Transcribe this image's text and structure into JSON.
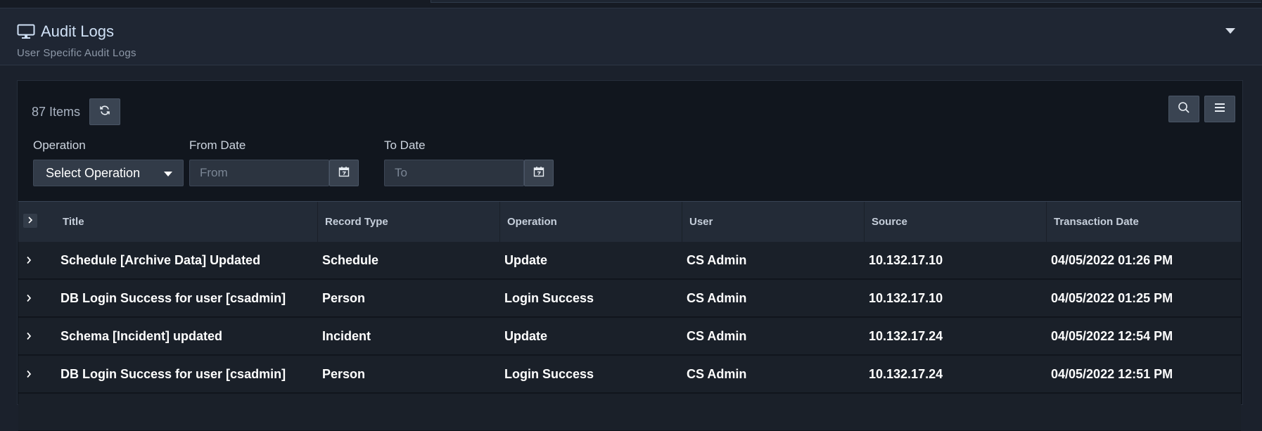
{
  "panel": {
    "title": "Audit Logs",
    "subtitle": "User Specific Audit Logs"
  },
  "toolbar": {
    "items_count": "87 Items",
    "refresh_icon": "refresh-icon",
    "search_icon": "search-icon",
    "menu_icon": "hamburger-menu-icon"
  },
  "filters": {
    "operation_label": "Operation",
    "operation_value": "Select Operation",
    "from_label": "From Date",
    "from_placeholder": "From",
    "to_label": "To Date",
    "to_placeholder": "To"
  },
  "grid": {
    "columns": [
      "Title",
      "Record Type",
      "Operation",
      "User",
      "Source",
      "Transaction Date"
    ],
    "rows": [
      [
        "Schedule [Archive Data] Updated",
        "Schedule",
        "Update",
        "CS Admin",
        "10.132.17.10",
        "04/05/2022 01:26 PM"
      ],
      [
        "DB Login Success for user [csadmin]",
        "Person",
        "Login Success",
        "CS Admin",
        "10.132.17.10",
        "04/05/2022 01:25 PM"
      ],
      [
        "Schema [Incident] updated",
        "Incident",
        "Update",
        "CS Admin",
        "10.132.17.24",
        "04/05/2022 12:54 PM"
      ],
      [
        "DB Login Success for user [csadmin]",
        "Person",
        "Login Success",
        "CS Admin",
        "10.132.17.24",
        "04/05/2022 12:51 PM"
      ]
    ]
  },
  "colors": {
    "page_bg": "#1b212c",
    "grid_bg": "#11161e",
    "row_bg": "#1a2029",
    "title_accent": "#cfe0f5"
  }
}
